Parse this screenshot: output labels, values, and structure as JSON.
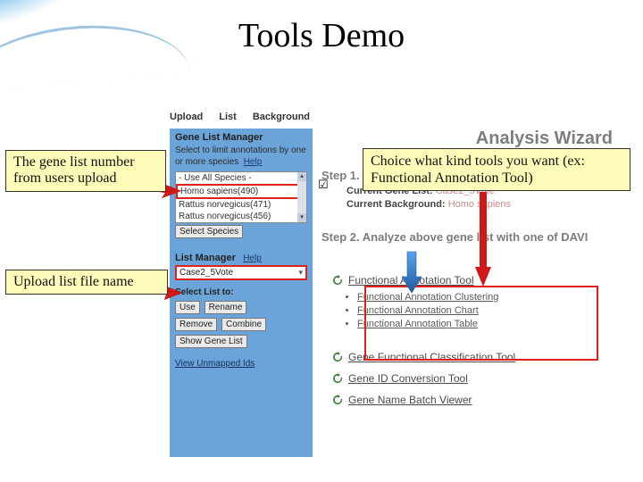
{
  "title": "Tools Demo",
  "callouts": {
    "c1": "The gene list number from users upload",
    "c2": "Choice what kind tools you want (ex: Functional Annotation Tool)",
    "c3": "Upload list file name"
  },
  "topbar": {
    "upload": "Upload",
    "list": "List",
    "background": "Background"
  },
  "sidebar": {
    "hdr1": "Gene List Manager",
    "text1a": "Select to limit annotations by one or more species",
    "help": "Help",
    "species": [
      "- Use All Species -",
      "Homo sapiens(490)",
      "Rattus norvegicus(471)",
      "Rattus norvegicus(456)"
    ],
    "selectSpeciesBtn": "Select Species",
    "hdr2_a": "List Manager",
    "hdr2_b": "Help",
    "listValue": "Case2_5Vote",
    "selectListLbl": "Select List to:",
    "btns": {
      "use": "Use",
      "rename": "Rename",
      "remove": "Remove",
      "combine": "Combine",
      "showGeneList": "Show Gene List"
    },
    "viewUnmapped": "View Unmapped Ids"
  },
  "main": {
    "wizard": "Analysis Wizard",
    "step1": "Step 1. Successfully submitted gene list",
    "cur_gene_k": "Current Gene List:",
    "cur_gene_v": "Case2_5Vote",
    "cur_bg_k": "Current Background:",
    "cur_bg_v": "Homo sapiens",
    "step2": "Step 2. Analyze above gene list with one of DAVI",
    "tools": {
      "fat": "Functional Annotation Tool",
      "fac": "Functional Annotation Clustering",
      "fach": "Functional Annotation Chart",
      "fatbl": "Functional Annotation Table",
      "gfct": "Gene Functional Classification Tool",
      "gict": "Gene ID Conversion Tool",
      "gnbv": "Gene Name Batch Viewer"
    }
  }
}
